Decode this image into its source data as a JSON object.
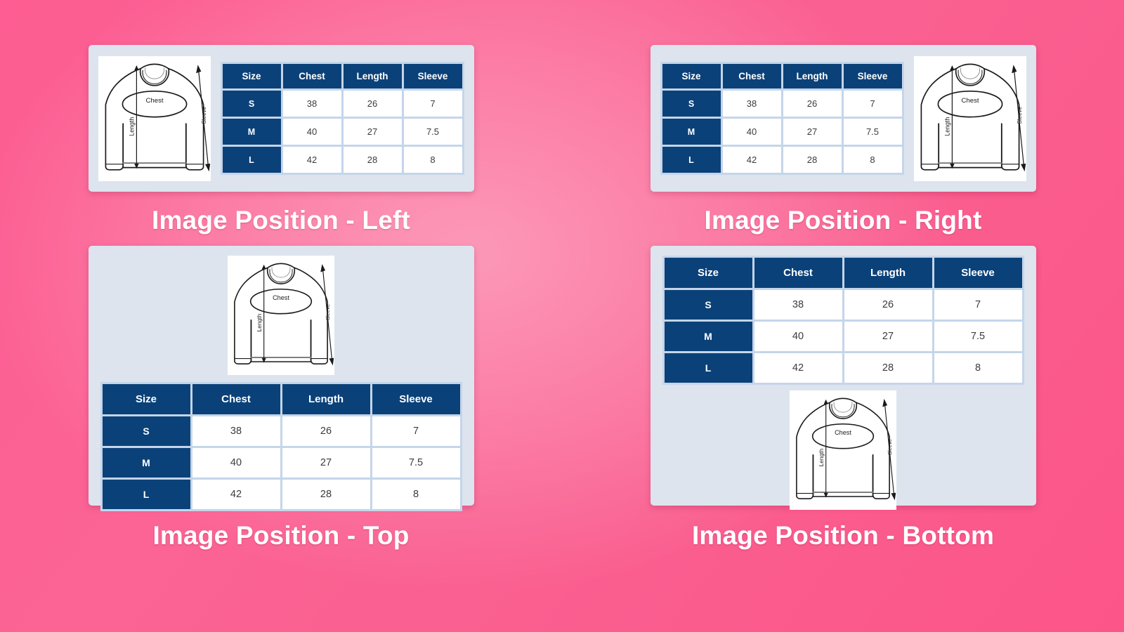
{
  "theme": {
    "background_pink": "#fb5a8e",
    "card_background": "#dde4ee",
    "table_header_navy": "#0b4179",
    "table_gridline": "#c5d5ea",
    "cell_background": "#ffffff",
    "caption_color": "#ffffff"
  },
  "panels": [
    {
      "id": "image-position-left",
      "caption": "Image Position - Left",
      "layout": "image-left",
      "illustration": {
        "alt": "long sleeve shirt measurement diagram",
        "labels": {
          "chest": "Chest",
          "length": "Length",
          "sleeve": "Sleeve"
        }
      },
      "table": {
        "columns": [
          "Size",
          "Chest",
          "Length",
          "Sleeve"
        ],
        "rows": [
          [
            "S",
            "38",
            "26",
            "7"
          ],
          [
            "M",
            "40",
            "27",
            "7.5"
          ],
          [
            "L",
            "42",
            "28",
            "8"
          ]
        ]
      }
    },
    {
      "id": "image-position-right",
      "caption": "Image Position - Right",
      "layout": "image-right",
      "illustration": {
        "alt": "long sleeve shirt measurement diagram",
        "labels": {
          "chest": "Chest",
          "length": "Length",
          "sleeve": "Sleeve"
        }
      },
      "table": {
        "columns": [
          "Size",
          "Chest",
          "Length",
          "Sleeve"
        ],
        "rows": [
          [
            "S",
            "38",
            "26",
            "7"
          ],
          [
            "M",
            "40",
            "27",
            "7.5"
          ],
          [
            "L",
            "42",
            "28",
            "8"
          ]
        ]
      }
    },
    {
      "id": "image-position-top",
      "caption": "Image Position - Top",
      "layout": "image-top",
      "illustration": {
        "alt": "long sleeve shirt measurement diagram",
        "labels": {
          "chest": "Chest",
          "length": "Length",
          "sleeve": "Sleeve"
        }
      },
      "table": {
        "columns": [
          "Size",
          "Chest",
          "Length",
          "Sleeve"
        ],
        "rows": [
          [
            "S",
            "38",
            "26",
            "7"
          ],
          [
            "M",
            "40",
            "27",
            "7.5"
          ],
          [
            "L",
            "42",
            "28",
            "8"
          ]
        ]
      }
    },
    {
      "id": "image-position-bottom",
      "caption": "Image Position - Bottom",
      "layout": "image-bottom",
      "illustration": {
        "alt": "long sleeve shirt measurement diagram",
        "labels": {
          "chest": "Chest",
          "length": "Length",
          "sleeve": "Sleeve"
        }
      },
      "table": {
        "columns": [
          "Size",
          "Chest",
          "Length",
          "Sleeve"
        ],
        "rows": [
          [
            "S",
            "38",
            "26",
            "7"
          ],
          [
            "M",
            "40",
            "27",
            "7.5"
          ],
          [
            "L",
            "42",
            "28",
            "8"
          ]
        ]
      }
    }
  ]
}
